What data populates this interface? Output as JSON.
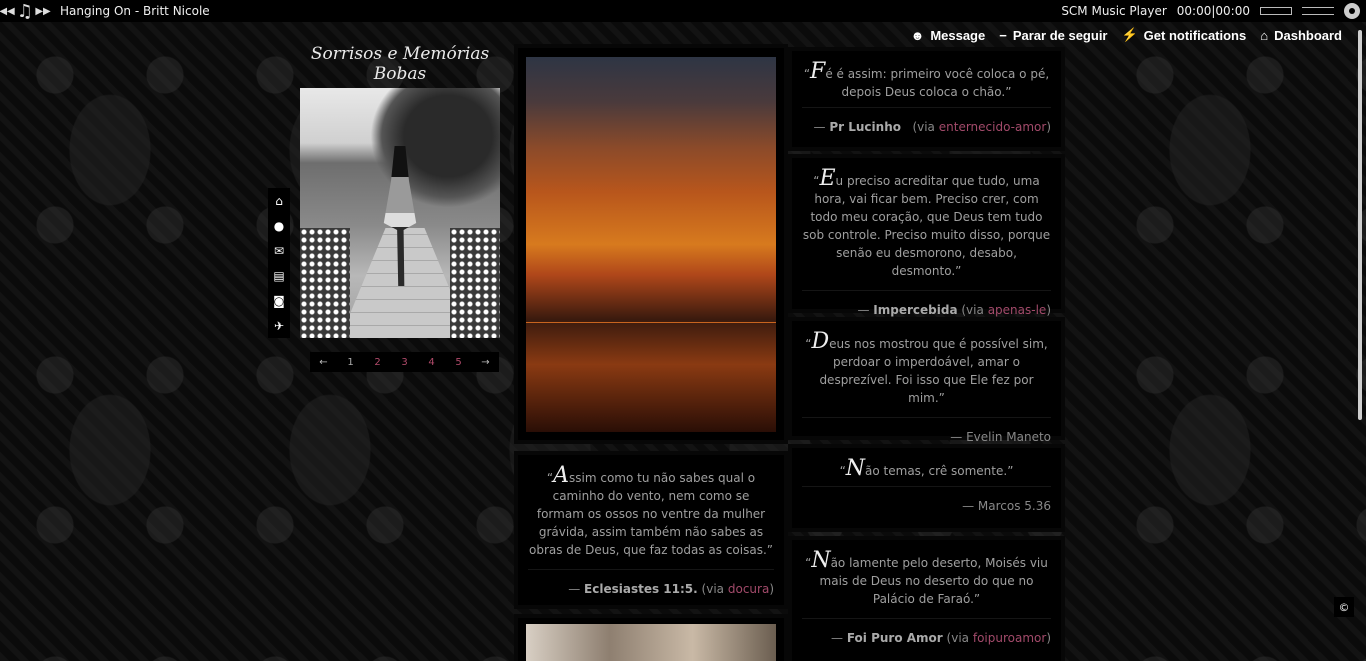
{
  "player": {
    "song": "Hanging On - Britt Nicole",
    "name": "SCM Music Player",
    "time": "00:00|00:00"
  },
  "tumblr": {
    "message": "Message",
    "unfollow": "Parar de seguir",
    "notifications": "Get notifications",
    "dashboard": "Dashboard"
  },
  "blog": {
    "title": "Sorrisos e Memórias Bobas"
  },
  "pagination": [
    "1",
    "2",
    "3",
    "4",
    "5"
  ],
  "posts": {
    "q1": {
      "first": "A",
      "text": "ssim como tu não sabes qual o caminho do vento, nem como se formam os ossos no ventre da mulher grávida, assim também não sabes as obras de Deus, que faz todas as coisas.”",
      "source": "Eclesiastes 11:5.",
      "via_label": "(via",
      "via": "docura",
      "via_end": ")"
    },
    "r1": {
      "first": "F",
      "text": "é é assim: primeiro você coloca o pé, depois Deus coloca o chão.”",
      "source": "Pr Lucinho",
      "via_label": "(via",
      "via": "enternecido-amor",
      "via_end": ")"
    },
    "r2": {
      "first": "E",
      "text": "u preciso acreditar que tudo, uma hora, vai ficar bem. Preciso crer, com todo meu coração, que Deus tem tudo sob controle. Preciso muito disso, porque senão eu desmorono, desabo, desmonto.”",
      "source": "Impercebida",
      "via_label": "(via",
      "via": "apenas-le",
      "via_end": ")"
    },
    "r3": {
      "first": "D",
      "text": "eus nos mostrou que é possível sim, perdoar o imperdoável, amar o desprezível. Foi isso que Ele fez por mim.”",
      "source": "— Evelin Maneto"
    },
    "r4": {
      "first": "N",
      "text": "ão temas, crê somente.”",
      "source": "— Marcos 5.36"
    },
    "r5": {
      "first": "N",
      "text": "ão lamente pelo deserto, Moisés viu mais de Deus no deserto do que no Palácio de Faraó.”",
      "source": "Foi Puro Amor",
      "via_label": "(via",
      "via": "foipuroamor",
      "via_end": ")"
    }
  },
  "copyright": "©"
}
